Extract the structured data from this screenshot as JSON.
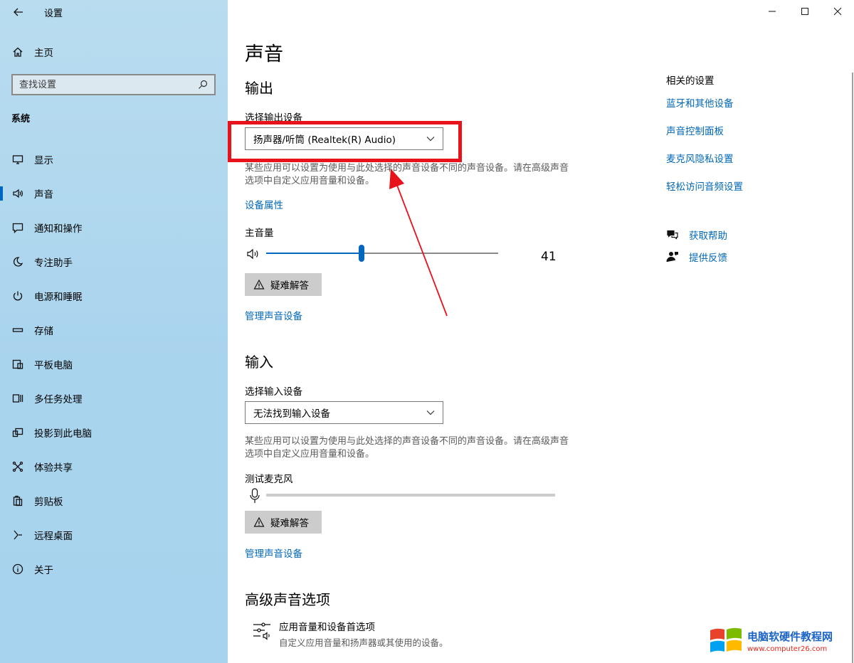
{
  "app": {
    "title": "设置"
  },
  "sidebar": {
    "home": "主页",
    "search_placeholder": "查找设置",
    "section": "系统",
    "items": [
      {
        "label": "显示",
        "icon": "monitor-icon"
      },
      {
        "label": "声音",
        "icon": "speaker-icon",
        "active": true
      },
      {
        "label": "通知和操作",
        "icon": "notification-icon"
      },
      {
        "label": "专注助手",
        "icon": "moon-icon"
      },
      {
        "label": "电源和睡眠",
        "icon": "power-icon"
      },
      {
        "label": "存储",
        "icon": "storage-icon"
      },
      {
        "label": "平板电脑",
        "icon": "tablet-icon"
      },
      {
        "label": "多任务处理",
        "icon": "multitask-icon"
      },
      {
        "label": "投影到此电脑",
        "icon": "project-icon"
      },
      {
        "label": "体验共享",
        "icon": "share-icon"
      },
      {
        "label": "剪贴板",
        "icon": "clipboard-icon"
      },
      {
        "label": "远程桌面",
        "icon": "remote-desktop-icon"
      },
      {
        "label": "关于",
        "icon": "info-icon"
      }
    ]
  },
  "main": {
    "title": "声音",
    "output": {
      "heading": "输出",
      "select_label": "选择输出设备",
      "device": "扬声器/听筒 (Realtek(R) Audio)",
      "desc": "某些应用可以设置为使用与此处选择的声音设备不同的声音设备。请在高级声音选项中自定义应用音量和设备。",
      "device_properties": "设备属性",
      "master_volume_label": "主音量",
      "volume": 41,
      "troubleshoot": "疑难解答",
      "manage": "管理声音设备"
    },
    "input": {
      "heading": "输入",
      "select_label": "选择输入设备",
      "device": "无法找到输入设备",
      "desc": "某些应用可以设置为使用与此处选择的声音设备不同的声音设备。请在高级声音选项中自定义应用音量和设备。",
      "test_mic_label": "测试麦克风",
      "troubleshoot": "疑难解答",
      "manage": "管理声音设备"
    },
    "advanced": {
      "heading": "高级声音选项",
      "item_title": "应用音量和设备首选项",
      "item_desc": "自定义应用音量和扬声器或其使用的设备。"
    }
  },
  "related": {
    "title": "相关的设置",
    "links": [
      "蓝牙和其他设备",
      "声音控制面板",
      "麦克风隐私设置",
      "轻松访问音频设置"
    ]
  },
  "help": {
    "get_help": "获取帮助",
    "feedback": "提供反馈"
  },
  "annotation": {
    "color": "#e8121b"
  },
  "colors": {
    "accent": "#0067c0",
    "link": "#0067b8",
    "sidebar_bg": "#a9d4ee"
  },
  "watermark": {
    "title": "电脑软硬件教程网",
    "url": "www.computer26.com"
  }
}
